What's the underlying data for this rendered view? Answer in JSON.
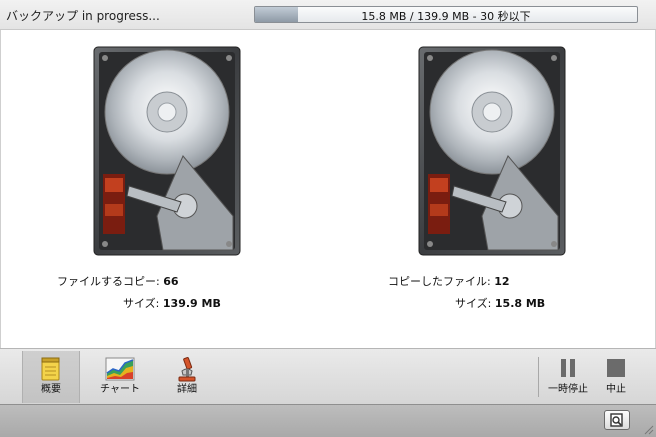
{
  "status": {
    "title": "バックアップ in progress...",
    "progress_fraction": 0.113,
    "progress_text": "15.8 MB / 139.9 MB - 30 秒以下"
  },
  "source": {
    "files_label": "ファイルするコピー:",
    "files_value": "66",
    "size_label": "サイズ:",
    "size_value": "139.9 MB"
  },
  "destination": {
    "files_label": "コピーしたファイル:",
    "files_value": "12",
    "size_label": "サイズ:",
    "size_value": "15.8 MB"
  },
  "toolbar": {
    "overview_label": "概要",
    "chart_label": "チャート",
    "details_label": "詳細",
    "pause_label": "一時停止",
    "stop_label": "中止"
  },
  "icons": {
    "overview": "notepad-icon",
    "chart": "chart-icon",
    "details": "microscope-icon",
    "pause": "pause-icon",
    "stop": "stop-icon",
    "quicklook": "quicklook-icon"
  }
}
